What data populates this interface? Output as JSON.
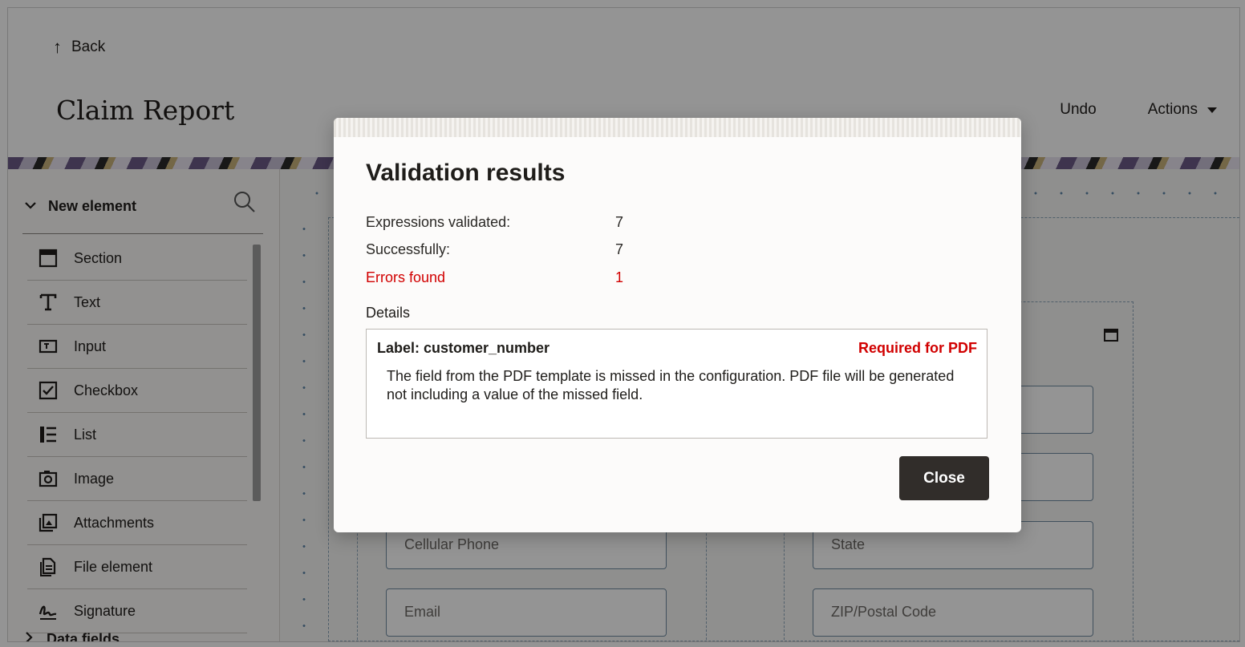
{
  "header": {
    "back_label": "Back",
    "title": "Claim Report",
    "undo_label": "Undo",
    "actions_label": "Actions"
  },
  "sidebar": {
    "heading": "New element",
    "items": [
      {
        "label": "Section",
        "icon": "section-icon"
      },
      {
        "label": "Text",
        "icon": "text-icon"
      },
      {
        "label": "Input",
        "icon": "input-icon"
      },
      {
        "label": "Checkbox",
        "icon": "checkbox-icon"
      },
      {
        "label": "List",
        "icon": "list-icon"
      },
      {
        "label": "Image",
        "icon": "image-icon"
      },
      {
        "label": "Attachments",
        "icon": "attachments-icon"
      },
      {
        "label": "File element",
        "icon": "file-element-icon"
      },
      {
        "label": "Signature",
        "icon": "signature-icon"
      }
    ],
    "footer_heading": "Data fields"
  },
  "canvas": {
    "fields": {
      "cellular_phone": "Cellular Phone",
      "state": "State",
      "email": "Email",
      "zip": "ZIP/Postal Code"
    }
  },
  "modal": {
    "title": "Validation results",
    "rows": [
      {
        "label": "Expressions validated:",
        "value": "7"
      },
      {
        "label": "Successfully:",
        "value": "7"
      },
      {
        "label": "Errors found",
        "value": "1"
      }
    ],
    "details_label": "Details",
    "detail": {
      "label": "Label: customer_number",
      "tag": "Required for PDF",
      "message": "The field from the PDF template is missed in the configuration. PDF file will be generated not including a value of the missed field."
    },
    "close_label": "Close"
  },
  "colors": {
    "error": "#d10000",
    "button_bg": "#312d2a",
    "overlay": "rgba(0,0,0,0.42)"
  }
}
